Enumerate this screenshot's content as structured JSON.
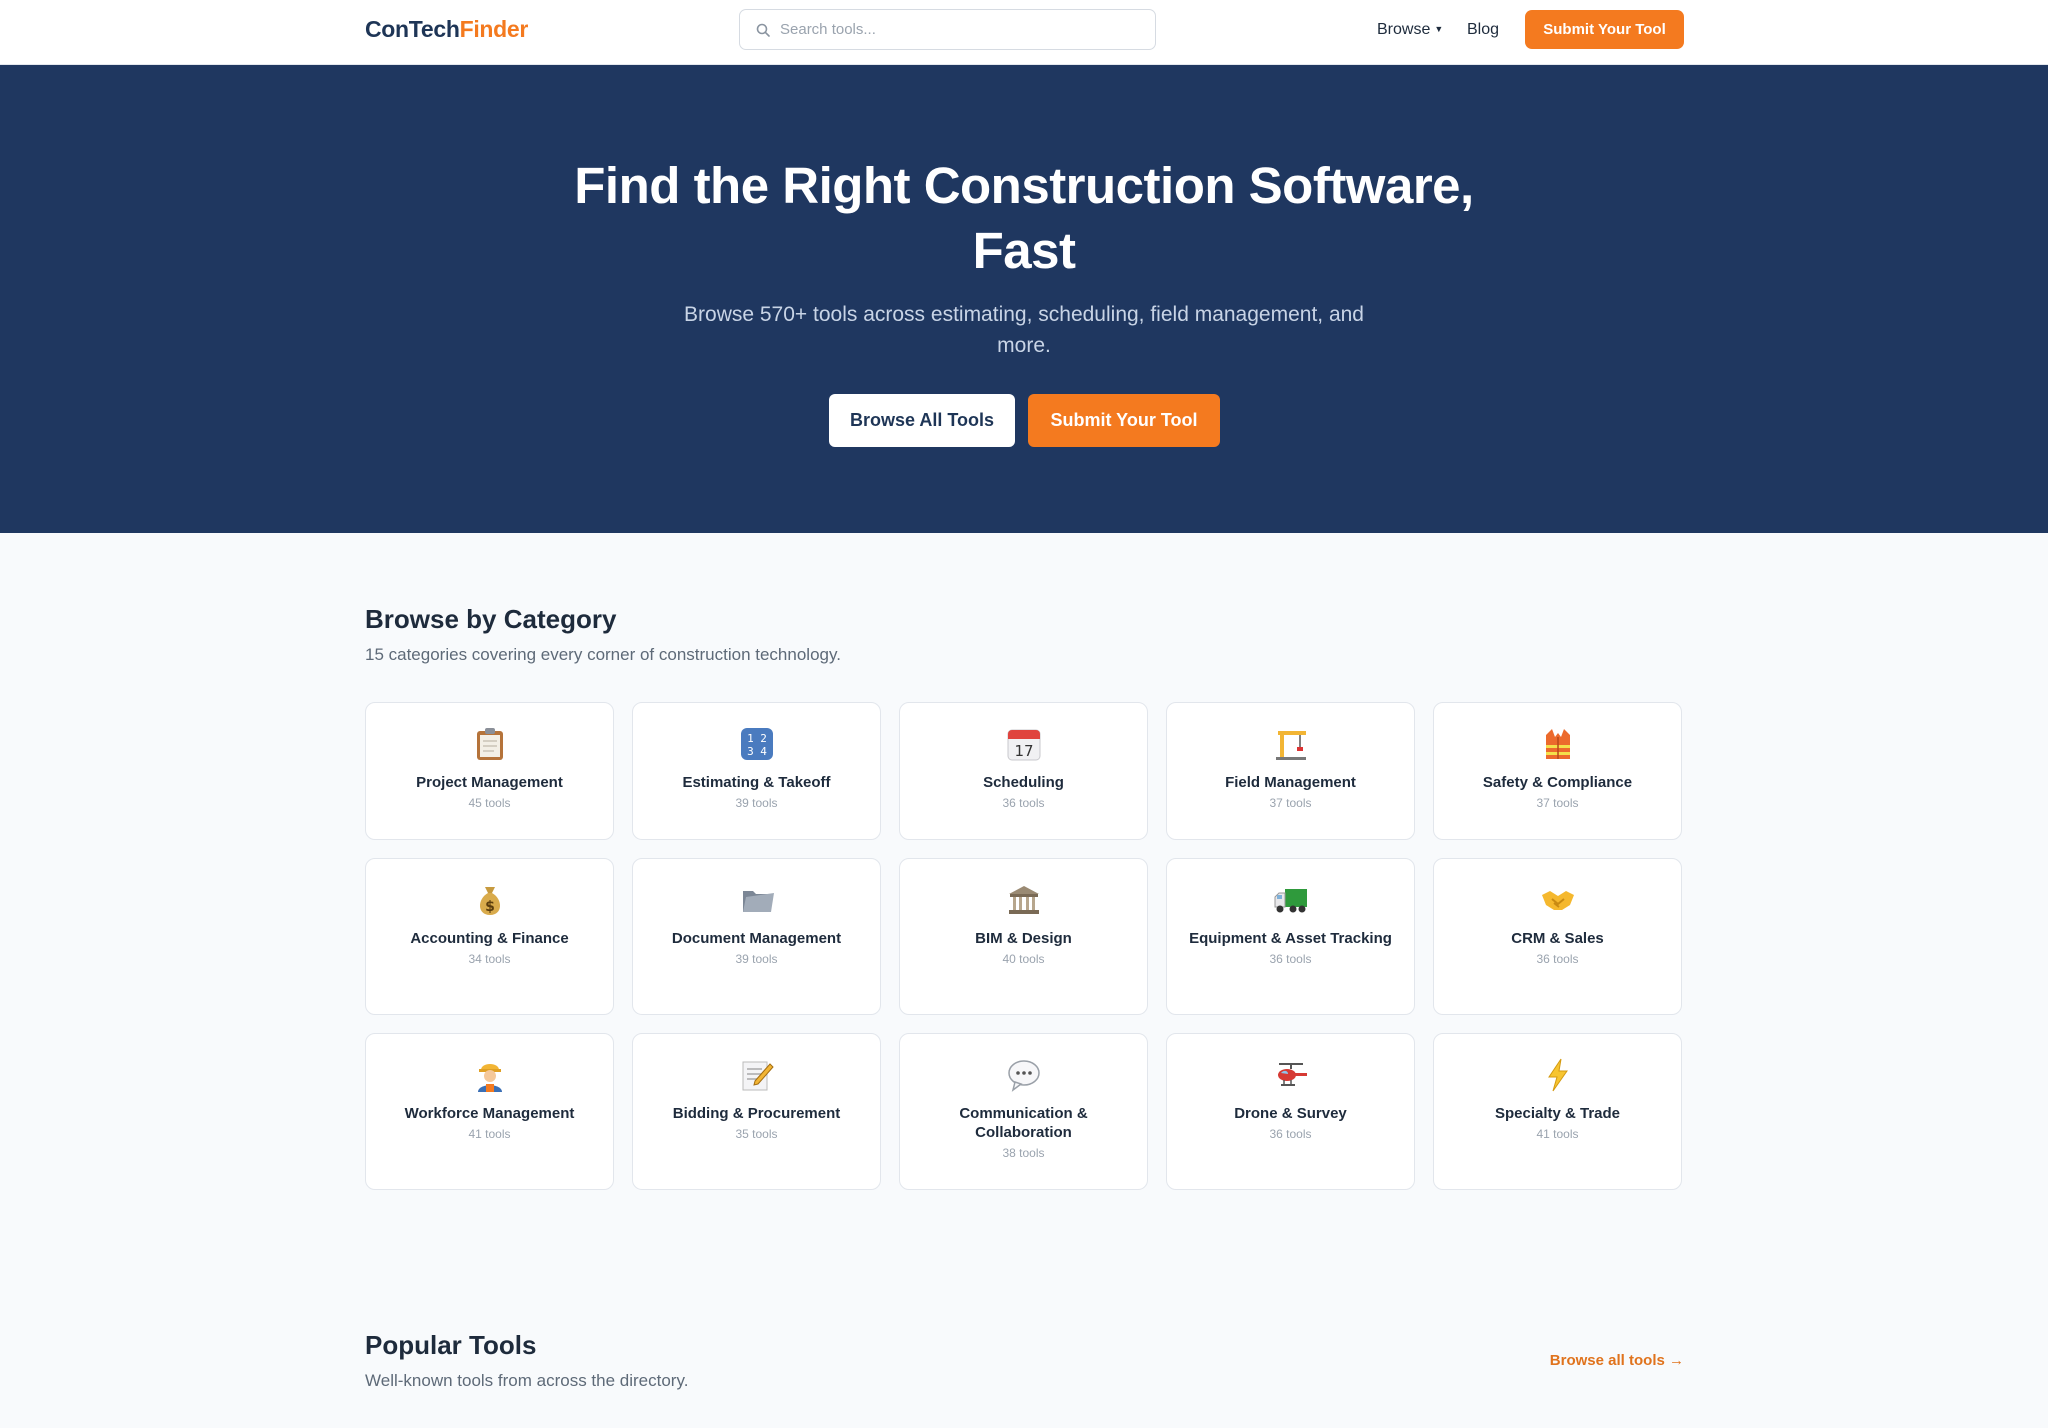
{
  "header": {
    "logo_part1": "ConTech",
    "logo_part2": "Finder",
    "search_placeholder": "Search tools...",
    "nav_browse": "Browse",
    "nav_blog": "Blog",
    "submit_button": "Submit Your Tool"
  },
  "hero": {
    "title": "Find the Right Construction Software, Fast",
    "subtitle": "Browse 570+ tools across estimating, scheduling, field management, and more.",
    "browse_button": "Browse All Tools",
    "submit_button": "Submit Your Tool"
  },
  "categories": {
    "title": "Browse by Category",
    "subtitle": "15 categories covering every corner of construction technology.",
    "items": [
      {
        "name": "Project Management",
        "count": "45 tools",
        "icon": "clipboard-icon"
      },
      {
        "name": "Estimating & Takeoff",
        "count": "39 tools",
        "icon": "numbers-icon"
      },
      {
        "name": "Scheduling",
        "count": "36 tools",
        "icon": "calendar-icon"
      },
      {
        "name": "Field Management",
        "count": "37 tools",
        "icon": "crane-icon"
      },
      {
        "name": "Safety & Compliance",
        "count": "37 tools",
        "icon": "safety-vest-icon"
      },
      {
        "name": "Accounting & Finance",
        "count": "34 tools",
        "icon": "money-bag-icon"
      },
      {
        "name": "Document Management",
        "count": "39 tools",
        "icon": "folder-icon"
      },
      {
        "name": "BIM & Design",
        "count": "40 tools",
        "icon": "classical-building-icon"
      },
      {
        "name": "Equipment & Asset Tracking",
        "count": "36 tools",
        "icon": "truck-icon"
      },
      {
        "name": "CRM & Sales",
        "count": "36 tools",
        "icon": "handshake-icon"
      },
      {
        "name": "Workforce Management",
        "count": "41 tools",
        "icon": "construction-worker-icon"
      },
      {
        "name": "Bidding & Procurement",
        "count": "35 tools",
        "icon": "memo-icon"
      },
      {
        "name": "Communication & Collaboration",
        "count": "38 tools",
        "icon": "speech-bubble-icon"
      },
      {
        "name": "Drone & Survey",
        "count": "36 tools",
        "icon": "helicopter-icon"
      },
      {
        "name": "Specialty & Trade",
        "count": "41 tools",
        "icon": "lightning-icon"
      }
    ]
  },
  "popular": {
    "title": "Popular Tools",
    "subtitle": "Well-known tools from across the directory.",
    "browse_link": "Browse all tools →"
  },
  "colors": {
    "brand_navy": "#1f3760",
    "accent_orange": "#f47a1f"
  }
}
